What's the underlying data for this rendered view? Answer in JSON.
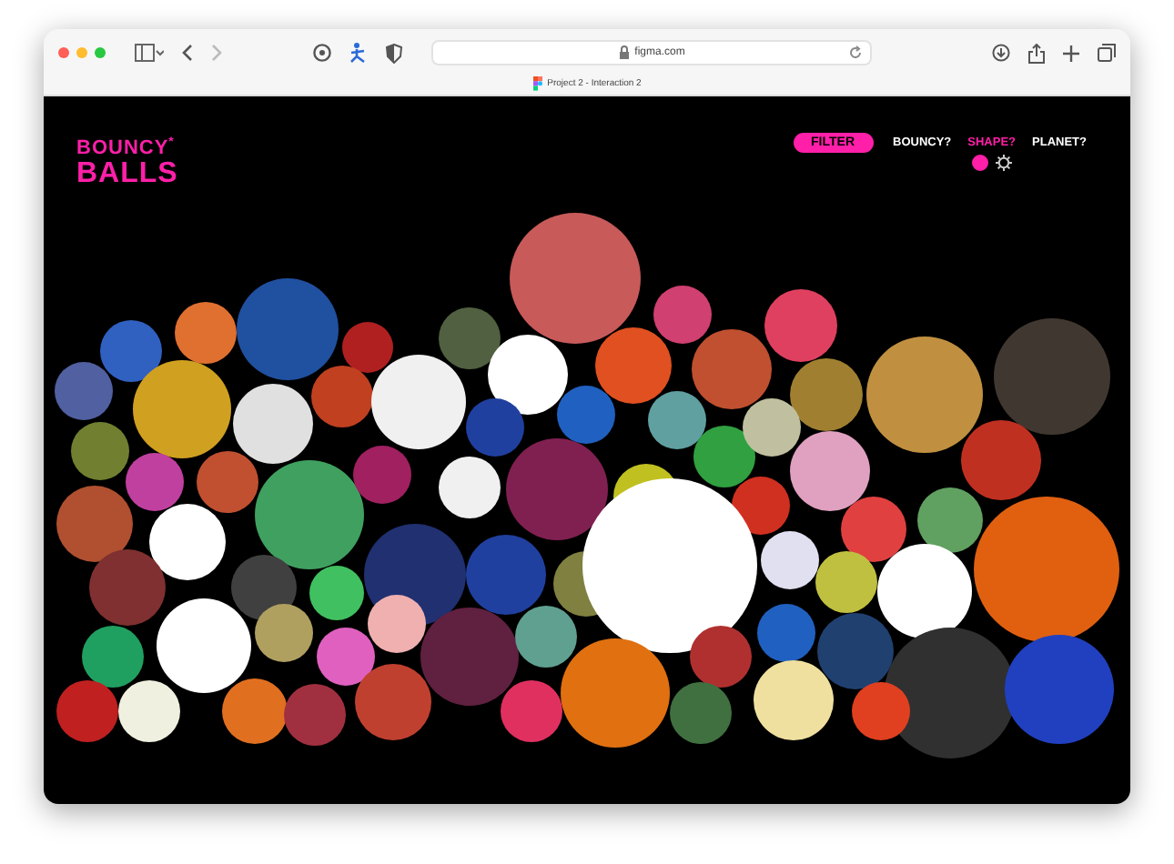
{
  "browser": {
    "address": "figma.com",
    "tab_title": "Project 2 - Interaction 2"
  },
  "logo": {
    "line_1": "BOUNCY",
    "mark": "*",
    "line_2": "BALLS"
  },
  "nav": [
    {
      "label": "FILTER",
      "kind": "pill",
      "selected": false
    },
    {
      "label": "BOUNCY?",
      "kind": "link",
      "selected": false
    },
    {
      "label": "SHAPE?",
      "kind": "link",
      "selected": true
    },
    {
      "label": "PLANET?",
      "kind": "link",
      "selected": false
    }
  ],
  "shape_options": [
    {
      "kind": "round",
      "selected": true
    },
    {
      "kind": "spiky",
      "selected": false
    }
  ]
}
